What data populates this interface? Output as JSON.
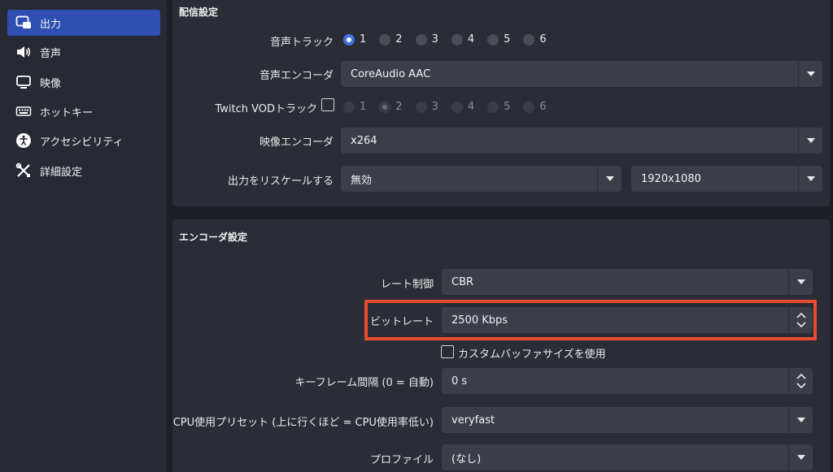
{
  "sidebar": {
    "items": [
      {
        "label": "出力",
        "icon": "monitor-output-icon",
        "active": true
      },
      {
        "label": "音声",
        "icon": "speaker-icon",
        "active": false
      },
      {
        "label": "映像",
        "icon": "display-icon",
        "active": false
      },
      {
        "label": "ホットキー",
        "icon": "keyboard-icon",
        "active": false
      },
      {
        "label": "アクセシビリティ",
        "icon": "accessibility-icon",
        "active": false
      },
      {
        "label": "詳細設定",
        "icon": "wrench-screwdriver-icon",
        "active": false
      }
    ]
  },
  "streaming": {
    "title": "配信設定",
    "audio_track": {
      "label": "音声トラック",
      "options": [
        "1",
        "2",
        "3",
        "4",
        "5",
        "6"
      ],
      "selected": "1"
    },
    "audio_encoder": {
      "label": "音声エンコーダ",
      "value": "CoreAudio AAC"
    },
    "twitch_vod": {
      "label": "Twitch VODトラック",
      "checked": false,
      "options": [
        "1",
        "2",
        "3",
        "4",
        "5",
        "6"
      ],
      "selected": "2"
    },
    "video_encoder": {
      "label": "映像エンコーダ",
      "value": "x264"
    },
    "rescale": {
      "label": "出力をリスケールする",
      "value": "無効",
      "resolution": "1920x1080"
    }
  },
  "encoder": {
    "title": "エンコーダ設定",
    "rate_control": {
      "label": "レート制御",
      "value": "CBR"
    },
    "bitrate": {
      "label": "ビットレート",
      "value": "2500 Kbps"
    },
    "custom_buffer": {
      "label": "カスタムバッファサイズを使用",
      "checked": false
    },
    "keyframe": {
      "label": "キーフレーム間隔 (0 = 自動)",
      "value": "0 s"
    },
    "cpu_preset": {
      "label": "CPU使用プリセット (上に行くほど = CPU使用率低い)",
      "value": "veryfast"
    },
    "profile": {
      "label": "プロファイル",
      "value": "(なし)"
    }
  },
  "colors": {
    "accent": "#2f4fb3",
    "highlight_border": "#e84b2f",
    "panel": "#2a2d36",
    "background": "#1d1f26"
  }
}
